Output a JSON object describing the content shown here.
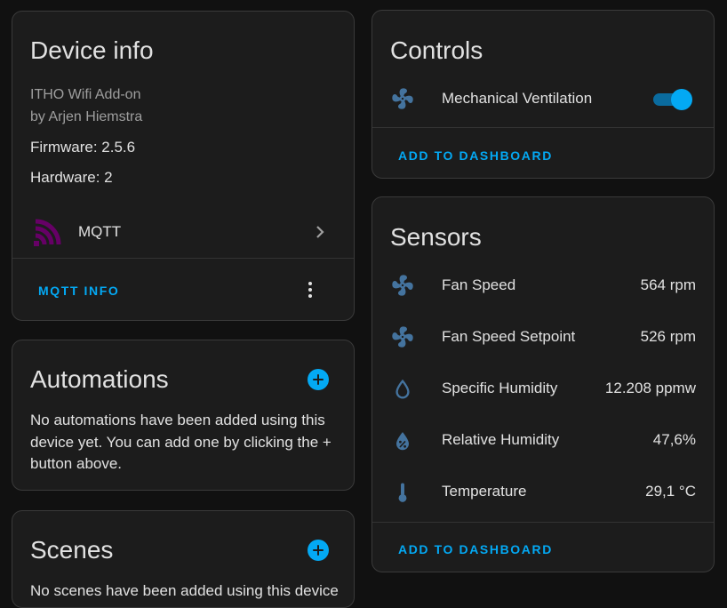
{
  "device_info": {
    "title": "Device info",
    "model": "ITHO Wifi Add-on",
    "manufacturer": "by Arjen Hiemstra",
    "firmware": "Firmware: 2.5.6",
    "hardware": "Hardware: 2",
    "integration": {
      "label": "MQTT",
      "icon": "mqtt-icon",
      "color": "#660066"
    },
    "action": "MQTT INFO"
  },
  "automations": {
    "title": "Automations",
    "description": "No automations have been added using this device yet. You can add one by clicking the + button above."
  },
  "scenes": {
    "title": "Scenes",
    "description": "No scenes have been added using this device"
  },
  "controls": {
    "title": "Controls",
    "items": [
      {
        "label": "Mechanical Ventilation",
        "icon": "fan-icon",
        "on": true
      }
    ],
    "action": "ADD TO DASHBOARD"
  },
  "sensors": {
    "title": "Sensors",
    "items": [
      {
        "label": "Fan Speed",
        "value": "564 rpm",
        "icon": "fan-icon"
      },
      {
        "label": "Fan Speed Setpoint",
        "value": "526 rpm",
        "icon": "fan-icon"
      },
      {
        "label": "Specific Humidity",
        "value": "12.208 ppmw",
        "icon": "water-drop-icon"
      },
      {
        "label": "Relative Humidity",
        "value": "47,6%",
        "icon": "water-percent-icon"
      },
      {
        "label": "Temperature",
        "value": "29,1 °C",
        "icon": "thermometer-icon"
      }
    ],
    "action": "ADD TO DASHBOARD"
  },
  "colors": {
    "accent": "#03a9f4",
    "icon": "#44739e",
    "card": "#1c1c1c",
    "background": "#111111"
  }
}
